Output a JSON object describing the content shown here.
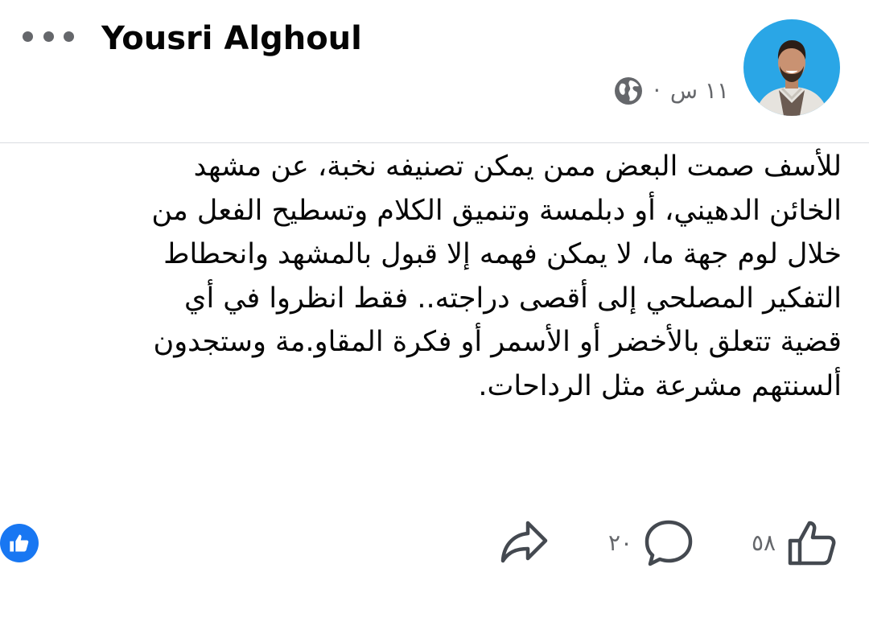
{
  "post": {
    "author_name": "Yousri Alghoul",
    "timestamp": "١١ س",
    "meta_separator": "·",
    "text_lines": [
      "للأسف صمت البعض ممن يمكن تصنيفه نخبة، عن مشهد",
      "الخائن الدهيني، أو دبلمسة وتنميق الكلام  وتسطيح الفعل من",
      "خلال لوم جهة ما، لا يمكن فهمه إلا قبول بالمشهد وانحطاط",
      "التفكير المصلحي إلى أقصى دراجته.. فقط انظروا في أي",
      "قضية تتعلق بالأخضر أو الأسمر أو فكرة المقاو.مة وستجدون",
      "ألسنتهم مشرعة مثل الرداحات."
    ]
  },
  "actions": {
    "like_count": "٥٨",
    "comment_count": "٢٠"
  },
  "icons": {
    "more": "more-dots-icon",
    "privacy": "globe-icon",
    "like": "thumbs-up-icon",
    "comment": "comment-bubble-icon",
    "share": "share-arrow-icon",
    "reaction": "like-reaction-icon"
  },
  "colors": {
    "accent": "#1877f2",
    "text_primary": "#050505",
    "text_secondary": "#65676b",
    "divider": "#dadde1"
  }
}
